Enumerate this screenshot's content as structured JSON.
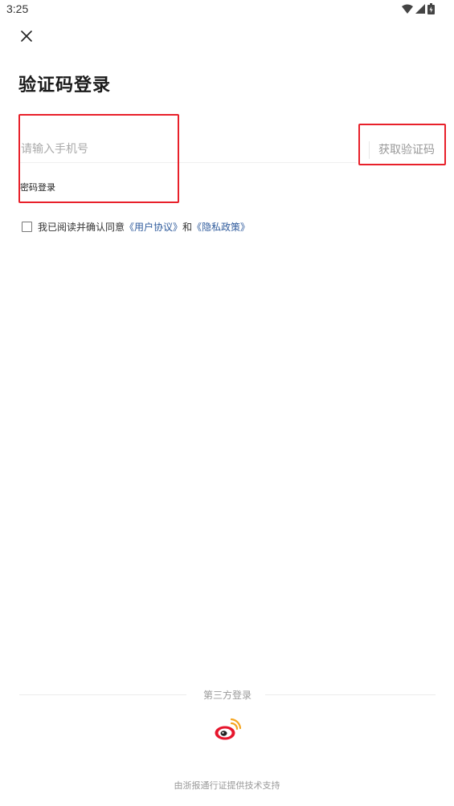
{
  "status_bar": {
    "time": "3:25",
    "icons": [
      "wifi-icon",
      "signal-icon",
      "battery-icon"
    ]
  },
  "header": {
    "close_icon": "close-icon",
    "title": "验证码登录"
  },
  "form": {
    "phone_placeholder": "请输入手机号",
    "phone_value": "",
    "get_code_label": "获取验证码",
    "password_login_label": "密码登录"
  },
  "agreement": {
    "checked": false,
    "prefix": "我已阅读并确认同意",
    "user_agreement": "《用户协议》",
    "conjunction": "和",
    "privacy_policy": "《隐私政策》"
  },
  "third_party": {
    "label": "第三方登录",
    "providers": [
      "weibo-icon"
    ]
  },
  "footer": {
    "text": "由浙报通行证提供技术支持"
  },
  "colors": {
    "highlight": "#e8202a",
    "link": "#2f5b9c",
    "weibo_red": "#e6162d",
    "weibo_orange": "#f5a623",
    "placeholder": "#aaaaaa"
  }
}
